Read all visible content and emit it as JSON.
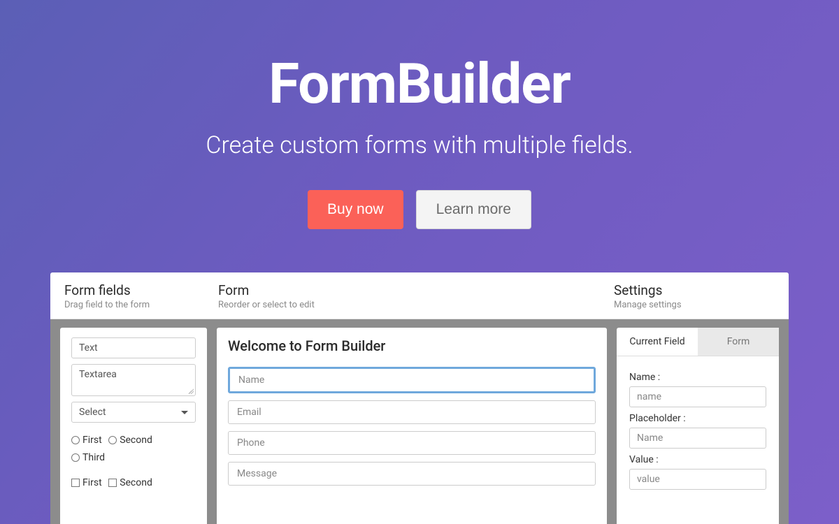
{
  "hero": {
    "title": "FormBuilder",
    "subtitle": "Create custom forms with multiple fields.",
    "buy_label": "Buy now",
    "learn_label": "Learn more"
  },
  "panels": {
    "fields": {
      "title": "Form fields",
      "hint": "Drag field to the form"
    },
    "form": {
      "title": "Form",
      "hint": "Reorder or select to edit"
    },
    "settings": {
      "title": "Settings",
      "hint": "Manage settings"
    }
  },
  "field_palette": {
    "text": "Text",
    "textarea": "Textarea",
    "select": "Select",
    "radio": [
      "First",
      "Second",
      "Third"
    ],
    "check": [
      "First",
      "Second"
    ]
  },
  "form_preview": {
    "title": "Welcome to Form Builder",
    "inputs": [
      "Name",
      "Email",
      "Phone",
      "Message"
    ]
  },
  "settings_panel": {
    "tab_current": "Current Field",
    "tab_form": "Form",
    "name_label": "Name :",
    "name_value": "name",
    "placeholder_label": "Placeholder :",
    "placeholder_value": "Name",
    "value_label": "Value :",
    "value_value": "value"
  }
}
